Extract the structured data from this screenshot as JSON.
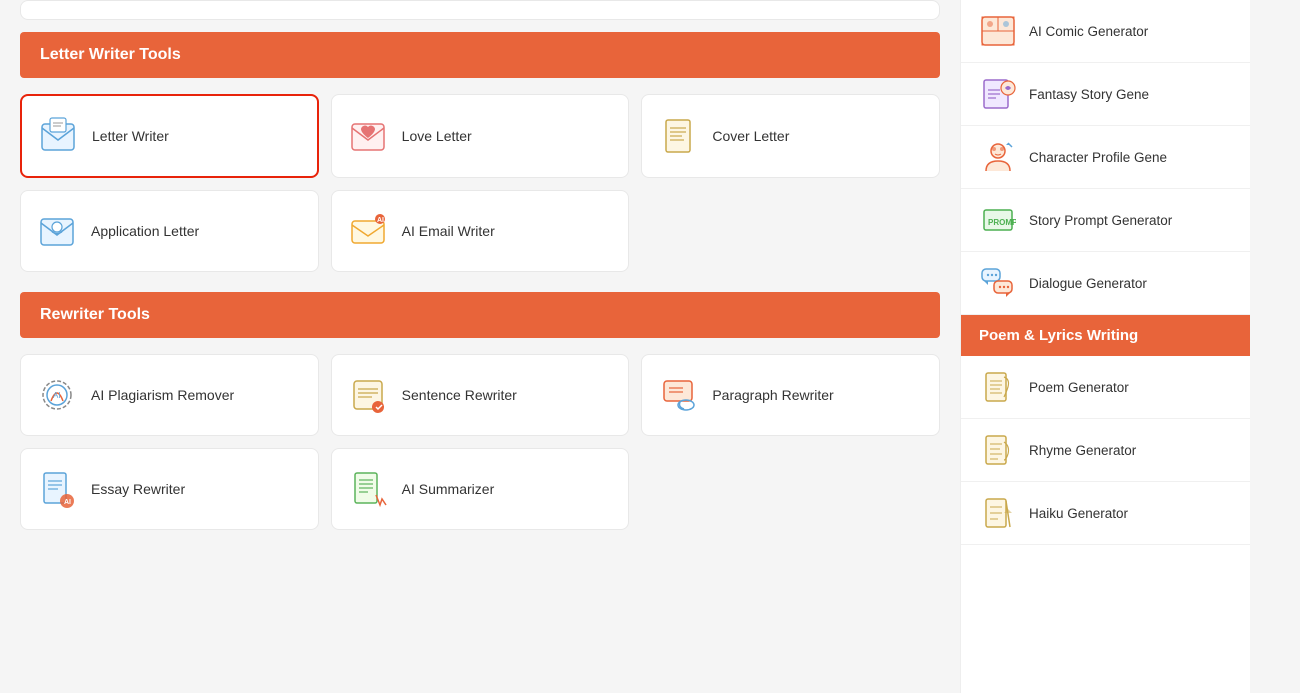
{
  "letterWriterTools": {
    "header": "Letter Writer Tools",
    "tools": [
      {
        "id": "letter-writer",
        "label": "Letter Writer",
        "icon": "✉️",
        "active": true
      },
      {
        "id": "love-letter",
        "label": "Love Letter",
        "icon": "💌",
        "active": false
      },
      {
        "id": "cover-letter",
        "label": "Cover Letter",
        "icon": "📄",
        "active": false
      },
      {
        "id": "application-letter",
        "label": "Application Letter",
        "icon": "📨",
        "active": false
      },
      {
        "id": "ai-email-writer",
        "label": "AI Email Writer",
        "icon": "📧",
        "active": false
      }
    ]
  },
  "rewriterTools": {
    "header": "Rewriter Tools",
    "tools": [
      {
        "id": "ai-plagiarism-remover",
        "label": "AI Plagiarism Remover",
        "icon": "🔄",
        "active": false
      },
      {
        "id": "sentence-rewriter",
        "label": "Sentence Rewriter",
        "icon": "📝",
        "active": false
      },
      {
        "id": "paragraph-rewriter",
        "label": "Paragraph Rewriter",
        "icon": "🎗️",
        "active": false
      },
      {
        "id": "essay-rewriter",
        "label": "Essay Rewriter",
        "icon": "📘",
        "active": false
      },
      {
        "id": "ai-summarizer",
        "label": "AI Summarizer",
        "icon": "📋",
        "active": false
      }
    ]
  },
  "sidebar": {
    "storySection": {
      "items": [
        {
          "id": "ai-comic-generator",
          "label": "AI Comic Generator",
          "icon": "🎨"
        },
        {
          "id": "fantasy-story-gene",
          "label": "Fantasy Story Gene",
          "icon": "🦄"
        },
        {
          "id": "character-profile-gene",
          "label": "Character Profile Gene",
          "icon": "🎭"
        },
        {
          "id": "story-prompt-generator",
          "label": "Story Prompt Generator",
          "icon": "📌"
        },
        {
          "id": "dialogue-generator",
          "label": "Dialogue Generator",
          "icon": "💬"
        }
      ]
    },
    "poemSection": {
      "header": "Poem & Lyrics Writing",
      "items": [
        {
          "id": "poem-generator",
          "label": "Poem Generator",
          "icon": "📜"
        },
        {
          "id": "rhyme-generator",
          "label": "Rhyme Generator",
          "icon": "🎵"
        },
        {
          "id": "haiku-generator",
          "label": "Haiku Generator",
          "icon": "🖊️"
        }
      ]
    }
  }
}
